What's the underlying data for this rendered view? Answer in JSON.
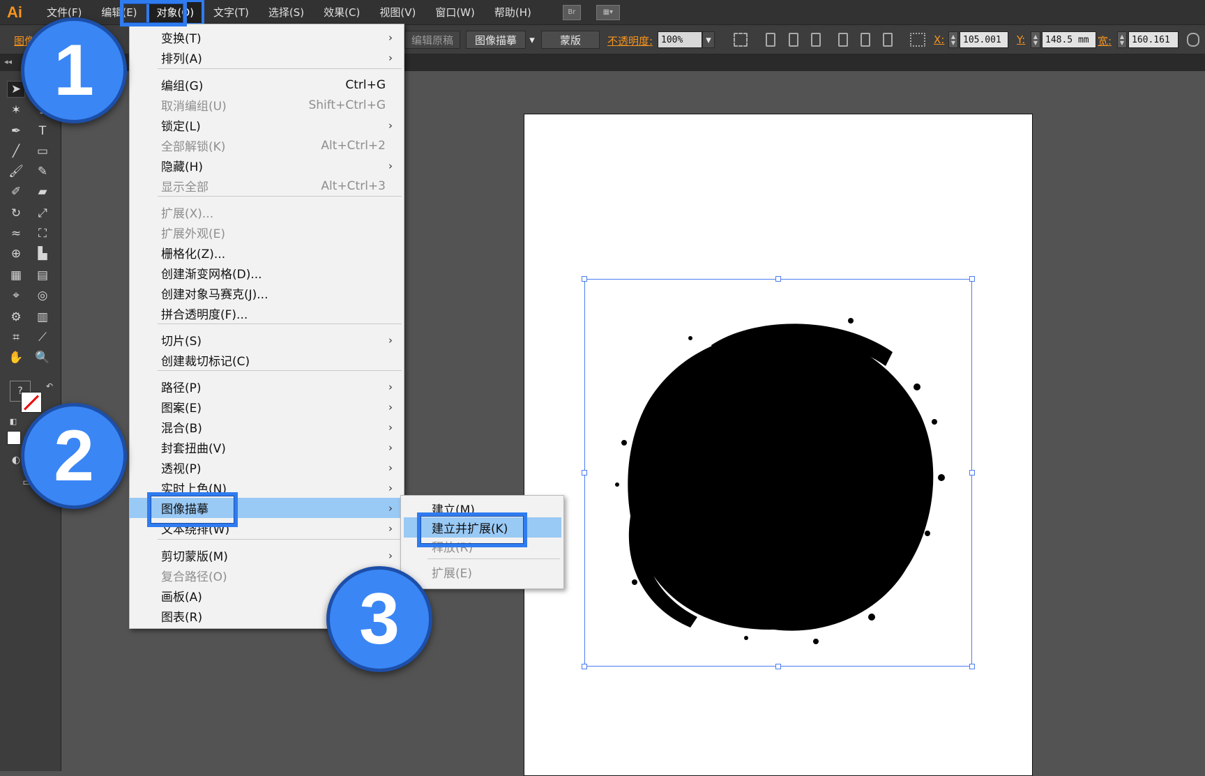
{
  "app": {
    "logo": "Ai"
  },
  "menubar": {
    "items": [
      "文件(F)",
      "编辑(E)",
      "对象(O)",
      "文字(T)",
      "选择(S)",
      "效果(C)",
      "视图(V)",
      "窗口(W)",
      "帮助(H)"
    ],
    "active_index": 2,
    "bridge_label": "Br"
  },
  "controlbar": {
    "left_label": "图像",
    "edit_original": "编辑原稿",
    "image_trace": "图像描摹",
    "mask": "蒙版",
    "opacity_label": "不透明度:",
    "opacity_value": "100%",
    "x_label": "X:",
    "x_value": "105.001",
    "y_label": "Y:",
    "y_value": "148.5 mm",
    "w_label": "宽:",
    "w_value": "160.161"
  },
  "tools": {
    "fill_stroke_unknown": "?"
  },
  "object_menu": {
    "items": [
      {
        "label": "变换(T)",
        "shortcut": "",
        "submenu": true,
        "disabled": false
      },
      {
        "label": "排列(A)",
        "shortcut": "",
        "submenu": true,
        "disabled": false
      },
      {
        "label": "编组(G)",
        "shortcut": "Ctrl+G",
        "submenu": false,
        "disabled": false
      },
      {
        "label": "取消编组(U)",
        "shortcut": "Shift+Ctrl+G",
        "submenu": false,
        "disabled": true
      },
      {
        "label": "锁定(L)",
        "shortcut": "",
        "submenu": true,
        "disabled": false
      },
      {
        "label": "全部解锁(K)",
        "shortcut": "Alt+Ctrl+2",
        "submenu": false,
        "disabled": true
      },
      {
        "label": "隐藏(H)",
        "shortcut": "",
        "submenu": true,
        "disabled": false
      },
      {
        "label": "显示全部",
        "shortcut": "Alt+Ctrl+3",
        "submenu": false,
        "disabled": true
      },
      {
        "label": "扩展(X)...",
        "shortcut": "",
        "submenu": false,
        "disabled": true
      },
      {
        "label": "扩展外观(E)",
        "shortcut": "",
        "submenu": false,
        "disabled": true
      },
      {
        "label": "栅格化(Z)...",
        "shortcut": "",
        "submenu": false,
        "disabled": false
      },
      {
        "label": "创建渐变网格(D)...",
        "shortcut": "",
        "submenu": false,
        "disabled": false
      },
      {
        "label": "创建对象马赛克(J)...",
        "shortcut": "",
        "submenu": false,
        "disabled": false
      },
      {
        "label": "拼合透明度(F)...",
        "shortcut": "",
        "submenu": false,
        "disabled": false
      },
      {
        "label": "切片(S)",
        "shortcut": "",
        "submenu": true,
        "disabled": false
      },
      {
        "label": "创建裁切标记(C)",
        "shortcut": "",
        "submenu": false,
        "disabled": false
      },
      {
        "label": "路径(P)",
        "shortcut": "",
        "submenu": true,
        "disabled": false
      },
      {
        "label": "图案(E)",
        "shortcut": "",
        "submenu": true,
        "disabled": false
      },
      {
        "label": "混合(B)",
        "shortcut": "",
        "submenu": true,
        "disabled": false
      },
      {
        "label": "封套扭曲(V)",
        "shortcut": "",
        "submenu": true,
        "disabled": false
      },
      {
        "label": "透视(P)",
        "shortcut": "",
        "submenu": true,
        "disabled": false
      },
      {
        "label": "实时上色(N)",
        "shortcut": "",
        "submenu": true,
        "disabled": false
      },
      {
        "label": "图像描摹",
        "shortcut": "",
        "submenu": true,
        "disabled": false,
        "highlighted": true
      },
      {
        "label": "文本绕排(W)",
        "shortcut": "",
        "submenu": true,
        "disabled": false
      },
      {
        "label": "剪切蒙版(M)",
        "shortcut": "",
        "submenu": true,
        "disabled": false
      },
      {
        "label": "复合路径(O)",
        "shortcut": "",
        "submenu": false,
        "disabled": true
      },
      {
        "label": "画板(A)",
        "shortcut": "",
        "submenu": false,
        "disabled": false
      },
      {
        "label": "图表(R)",
        "shortcut": "",
        "submenu": false,
        "disabled": false
      }
    ]
  },
  "trace_submenu": {
    "items": [
      {
        "label": "建立(M)",
        "disabled": false
      },
      {
        "label": "建立并扩展(K)",
        "disabled": false,
        "highlighted": true
      },
      {
        "label": "释放(R)",
        "disabled": true
      },
      {
        "label": "扩展(E)",
        "disabled": true
      }
    ]
  },
  "steps": [
    "1",
    "2",
    "3"
  ],
  "colors": {
    "accent_blue": "#2f7bf0",
    "badge_blue": "#3a86f5",
    "highlight": "#99c9f5",
    "logo_orange": "#f7941d"
  }
}
